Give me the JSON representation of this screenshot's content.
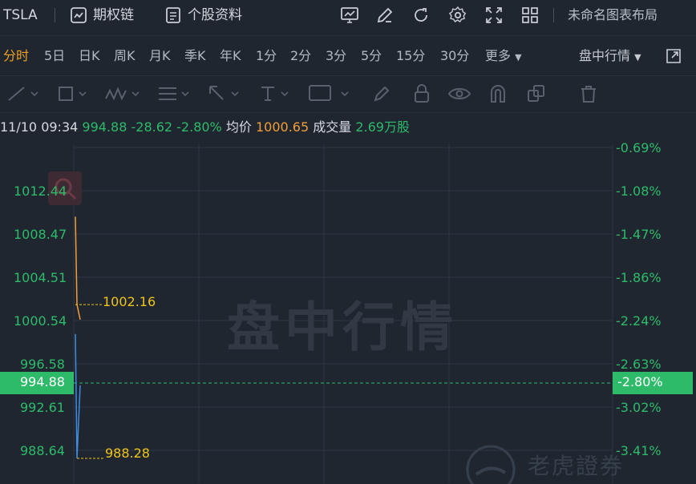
{
  "toolbar": {
    "symbol": "TSLA",
    "options_chain": "期权链",
    "stock_profile": "个股资料",
    "layout_name": "未命名图表布局"
  },
  "periods": {
    "items": [
      "分时",
      "5日",
      "日K",
      "周K",
      "月K",
      "季K",
      "年K",
      "1分",
      "2分",
      "3分",
      "5分",
      "15分",
      "30分"
    ],
    "active": "分时",
    "more": "更多",
    "session": "盘中行情"
  },
  "info": {
    "datetime": "11/10 09:34",
    "price": "994.88",
    "change": "-28.62",
    "change_pct": "-2.80%",
    "avg_label": "均价",
    "avg_value": "1000.65",
    "volume_label": "成交量",
    "volume_value": "2.69万股"
  },
  "chart": {
    "left_axis": [
      "1012.44",
      "1008.47",
      "1004.51",
      "1000.54",
      "996.58",
      "992.61",
      "988.64"
    ],
    "right_axis": [
      "-0.69%",
      "-1.08%",
      "-1.47%",
      "-1.86%",
      "-2.24%",
      "-2.63%",
      "-3.02%",
      "-3.41%"
    ],
    "current_price": "994.88",
    "current_pct": "-2.80%",
    "high_label": "1002.16",
    "low_label": "988.28",
    "watermark": "盘中行情",
    "brand": "老虎證券"
  },
  "chart_data": {
    "type": "line",
    "series": [
      {
        "values": [
          1010.1,
          1002.16,
          1000.8
        ]
      },
      {
        "values": [
          999.5,
          988.28,
          994.88
        ]
      }
    ],
    "ylim": [
      987.0,
      1016.0
    ],
    "grid": true
  },
  "colors": {
    "background": "#1f2630",
    "up_green": "#2dbb6a",
    "avg_orange": "#f29e38",
    "price_blue": "#3f8ce0",
    "accent": "#f0a020"
  }
}
